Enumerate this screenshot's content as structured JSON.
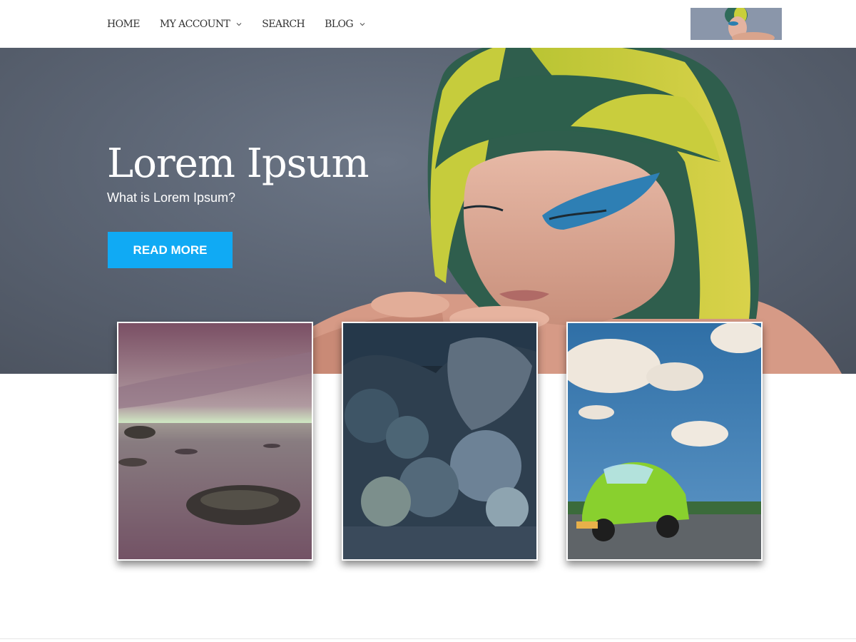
{
  "nav": {
    "items": [
      {
        "label": "HOME",
        "has_dropdown": false
      },
      {
        "label": "MY ACCOUNT",
        "has_dropdown": true
      },
      {
        "label": "SEARCH",
        "has_dropdown": false
      },
      {
        "label": "BLOG",
        "has_dropdown": true
      }
    ]
  },
  "hero": {
    "title": "Lorem Ipsum",
    "subtitle": "What is Lorem Ipsum?",
    "button_label": "READ MORE"
  },
  "gallery": [
    {
      "subject": "seascape-rocks-at-dusk"
    },
    {
      "subject": "underwater-coral-reef"
    },
    {
      "subject": "green-beetle-car-under-sky"
    }
  ],
  "colors": {
    "accent": "#10aaf4",
    "hero_bg": "#5b6473",
    "nav_text": "#333333"
  }
}
